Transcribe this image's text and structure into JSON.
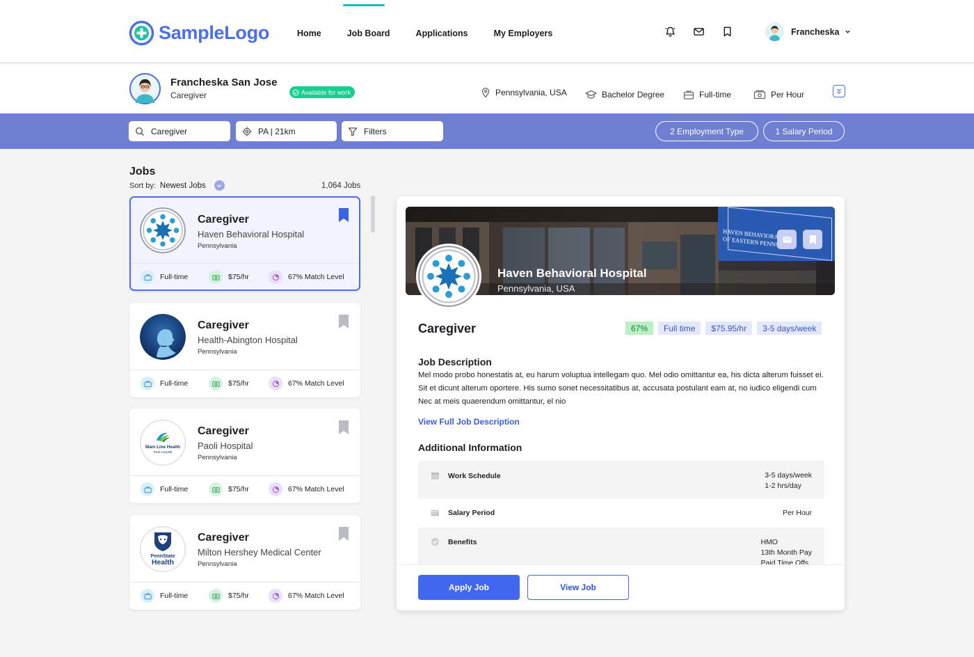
{
  "nav": {
    "logo_text": "SampleLogo",
    "links": [
      "Home",
      "Job Board",
      "Applications",
      "My Employers"
    ],
    "active_link": "Job Board",
    "icons": [
      "bell-icon",
      "mail-icon",
      "bookmark-icon"
    ],
    "user_name": "Francheska"
  },
  "profile": {
    "name": "Francheska San Jose",
    "role": "Caregiver",
    "status": "Available for work",
    "location": "Pennsylvania, USA",
    "education": "Bachelor Degree",
    "employment": "Full-time",
    "pay": "Per Hour"
  },
  "search": {
    "keyword": "Caregiver",
    "location": "PA | 21km",
    "filters_label": "Filters",
    "employment_type_btn": "2 Employment Type",
    "salary_period_btn": "1 Salary Period"
  },
  "jobs": {
    "heading": "Jobs",
    "sort_label": "Sort by:",
    "sort_value": "Newest Jobs",
    "count": "1,064 Jobs",
    "items": [
      {
        "title": "Caregiver",
        "company": "Haven Behavioral Hospital",
        "location": "Pennsylvania",
        "type": "Full-time",
        "rate": "$75/hr",
        "match": "67% Match Level",
        "saved": true
      },
      {
        "title": "Caregiver",
        "company": "Health-Abington Hospital",
        "location": "Pennsylvania",
        "type": "Full-time",
        "rate": "$75/hr",
        "match": "67% Match Level",
        "saved": false
      },
      {
        "title": "Caregiver",
        "company": "Paoli Hospital",
        "location": "Pennsylvania",
        "type": "Full-time",
        "rate": "$75/hr",
        "match": "67% Match Level",
        "saved": false
      },
      {
        "title": "Caregiver",
        "company": "Milton Hershey Medical Center",
        "location": "Pennsylvania",
        "type": "Full-time",
        "rate": "$75/hr",
        "match": "67% Match Level",
        "saved": false
      }
    ],
    "logo_texts": {
      "mainline_1": "Main Line Health",
      "mainline_2": "Paoli Hospital",
      "pennstate_1": "PennState",
      "pennstate_2": "Health"
    }
  },
  "detail": {
    "hospital": "Haven Behavioral Hospital",
    "location": "Pennsylvania, USA",
    "banner_sign_1": "HAVEN BEHAVIORAL HOS",
    "banner_sign_2": "OF EASTERN PENNSYLV",
    "title": "Caregiver",
    "tags": [
      "67%",
      "Full time",
      "$75.95/hr",
      "3-5 days/week"
    ],
    "job_description_heading": "Job Description",
    "description": "Mel modo probo honestatis at, eu harum voluptua intellegam quo. Mel odio omittantur ea, his dicta alterum fuisset ei. Sit et dicunt alterum oportere. His sumo sonet necessitatibus at, accusata postulant eam at, no iudico eligendi cum Nec at meis quaerendum omittantur, el nio",
    "view_full_link": "View Full Job Description",
    "additional_heading": "Additional Information",
    "info": [
      {
        "label": "Work Schedule",
        "values": [
          "3-5 days/week",
          "1-2 hrs/day"
        ]
      },
      {
        "label": "Salary Period",
        "values": [
          "Per Hour"
        ]
      },
      {
        "label": "Benefits",
        "values": [
          "HMO",
          "13th Month Pay",
          "Paid Time Offs"
        ]
      }
    ],
    "apply_label": "Apply Job",
    "view_label": "View Job"
  },
  "colors": {
    "brand": "#4b6fe8",
    "search_bar": "#6f7fd1",
    "available": "#16cf8e",
    "match_tag": "#b8f2c4",
    "info_tag": "#e4e8fb"
  }
}
